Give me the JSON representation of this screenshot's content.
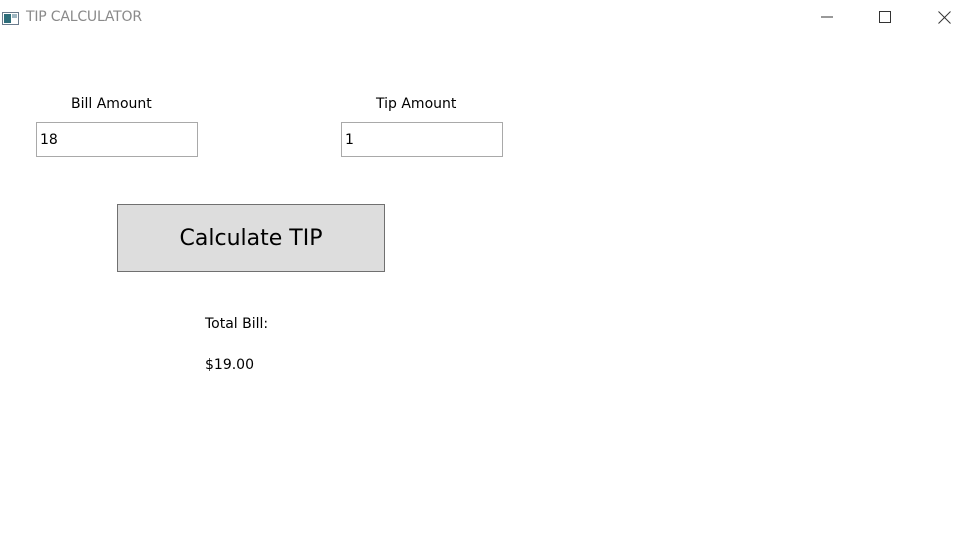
{
  "window": {
    "title": "TIP CALCULATOR",
    "controls": [
      "minimize",
      "maximize",
      "close"
    ]
  },
  "form": {
    "bill_label": "Bill Amount",
    "bill_value": "18",
    "tip_label": "Tip Amount",
    "tip_value": "1",
    "calculate_label": "Calculate TIP"
  },
  "result": {
    "total_label": "Total Bill:",
    "total_value": "$19.00"
  },
  "colors": {
    "button_background": "#dddddd",
    "button_border": "#707070",
    "textbox_border": "#a9a9a9",
    "title_text": "#8a8a8a"
  },
  "icons": {
    "app": "window-app-icon",
    "minimize": "minimize-icon",
    "maximize": "maximize-icon",
    "close": "close-icon"
  }
}
